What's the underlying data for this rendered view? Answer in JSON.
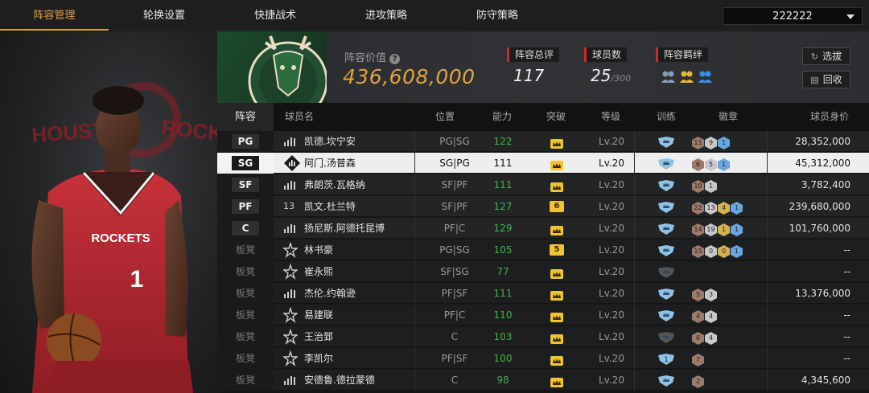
{
  "nav": {
    "tabs": [
      "阵容管理",
      "轮换设置",
      "快捷战术",
      "进攻策略",
      "防守策略"
    ],
    "active_index": 0,
    "team_select_value": "222222"
  },
  "header": {
    "value_label": "阵容价值",
    "value_amount": "436,608,000",
    "overall_label": "阵容总评",
    "overall_value": "117",
    "count_label": "球员数",
    "count_value": "25",
    "count_max": "/300",
    "chemistry_label": "阵容羁绊",
    "btn_scout": "选拔",
    "btn_recycle": "回收",
    "accent": "#e0a43c"
  },
  "table": {
    "columns": [
      "阵容",
      "球员名",
      "位置",
      "能力",
      "突破",
      "等级",
      "训练",
      "徽章",
      "球员身价"
    ],
    "rows": [
      {
        "slot": "PG",
        "starter": true,
        "tier": "bars",
        "name": "凯德.坎宁安",
        "pos": "PG|SG",
        "ability": "122",
        "breakthrough": "crown",
        "level": "Lv.20",
        "train": "crown",
        "badges": [
          "11",
          "9",
          "1"
        ],
        "value": "28,352,000"
      },
      {
        "slot": "SG",
        "starter": true,
        "tier": "diamond",
        "name": "阿门.汤普森",
        "pos": "SG|PG",
        "ability": "111",
        "breakthrough": "crown",
        "level": "Lv.20",
        "train": "crown",
        "badges": [
          "6",
          "5",
          "1"
        ],
        "value": "45,312,000"
      },
      {
        "slot": "SF",
        "starter": true,
        "tier": "bars",
        "name": "弗朗茨.瓦格纳",
        "pos": "SF|PF",
        "ability": "111",
        "breakthrough": "crown",
        "level": "Lv.20",
        "train": "crown",
        "badges": [
          "10",
          "1"
        ],
        "value": "3,782,400"
      },
      {
        "slot": "PF",
        "starter": true,
        "tier": "13",
        "name": "凯文.杜兰特",
        "pos": "SF|PF",
        "ability": "127",
        "breakthrough": "6",
        "level": "Lv.20",
        "train": "crown",
        "badges": [
          "22",
          "13",
          "4",
          "1"
        ],
        "value": "239,680,000"
      },
      {
        "slot": "C",
        "starter": true,
        "tier": "bars",
        "name": "扬尼斯.阿德托昆博",
        "pos": "PF|C",
        "ability": "129",
        "breakthrough": "crown",
        "level": "Lv.20",
        "train": "crown",
        "badges": [
          "14",
          "19",
          "1",
          "1"
        ],
        "value": "101,760,000"
      },
      {
        "slot": "板凳",
        "starter": false,
        "tier": "star",
        "name": "林书豪",
        "pos": "PG|SG",
        "ability": "105",
        "breakthrough": "5",
        "level": "Lv.20",
        "train": "crown",
        "badges": [
          "15",
          "0",
          "0",
          "1"
        ],
        "value": "--"
      },
      {
        "slot": "板凳",
        "starter": false,
        "tier": "star",
        "name": "崔永熙",
        "pos": "SF|SG",
        "ability": "77",
        "breakthrough": "crown",
        "level": "Lv.20",
        "train": "grey",
        "badges": [],
        "value": "--"
      },
      {
        "slot": "板凳",
        "starter": false,
        "tier": "bars",
        "name": "杰伦.约翰逊",
        "pos": "PF|SF",
        "ability": "111",
        "breakthrough": "crown",
        "level": "Lv.20",
        "train": "crown",
        "badges": [
          "5",
          "3"
        ],
        "value": "13,376,000"
      },
      {
        "slot": "板凳",
        "starter": false,
        "tier": "star",
        "name": "易建联",
        "pos": "PF|C",
        "ability": "110",
        "breakthrough": "crown",
        "level": "Lv.20",
        "train": "crown",
        "badges": [
          "4",
          "4"
        ],
        "value": "--"
      },
      {
        "slot": "板凳",
        "starter": false,
        "tier": "star",
        "name": "王治郅",
        "pos": "C",
        "ability": "103",
        "breakthrough": "crown",
        "level": "Lv.20",
        "train": "grey",
        "badges": [
          "6",
          "4"
        ],
        "value": "--"
      },
      {
        "slot": "板凳",
        "starter": false,
        "tier": "star",
        "name": "李凯尔",
        "pos": "PF|SF",
        "ability": "100",
        "breakthrough": "crown",
        "level": "Lv.20",
        "train": "1",
        "badges": [
          "7"
        ],
        "value": "--"
      },
      {
        "slot": "板凳",
        "starter": false,
        "tier": "bars",
        "name": "安德鲁.德拉蒙德",
        "pos": "C",
        "ability": "98",
        "breakthrough": "crown",
        "level": "Lv.20",
        "train": "crown",
        "badges": [
          "2"
        ],
        "value": "4,345,600"
      }
    ],
    "selected_index": 1
  },
  "portrait": {
    "jersey_team": "ROCKETS",
    "jersey_number": "1",
    "backdrop_text_left": "HOUST",
    "backdrop_text_right": "ROCK"
  }
}
